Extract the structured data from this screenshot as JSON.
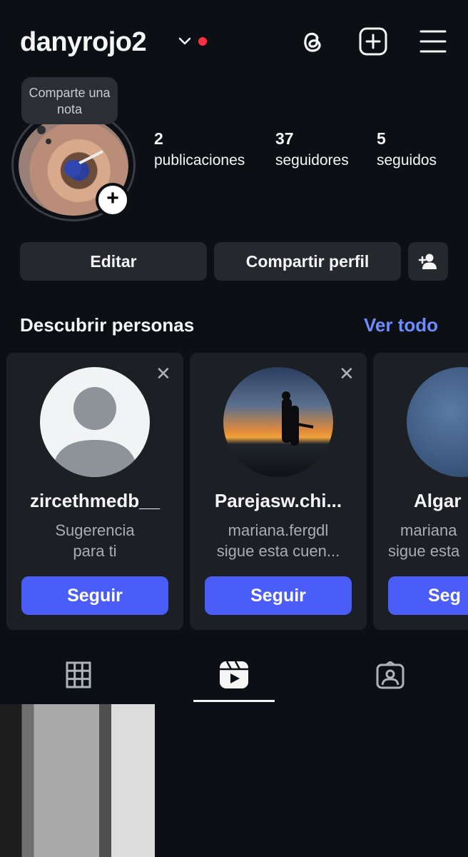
{
  "header": {
    "username": "danyrojo2",
    "icons": [
      "chevron-down-icon",
      "threads-icon",
      "add-square-icon",
      "menu-icon"
    ]
  },
  "profile": {
    "note_placeholder": "Comparte una nota",
    "stats": [
      {
        "value": "2",
        "label": "publicaciones"
      },
      {
        "value": "37",
        "label": "seguidores"
      },
      {
        "value": "5",
        "label": "seguidos"
      }
    ]
  },
  "actions": {
    "edit": "Editar",
    "share": "Compartir perfil"
  },
  "discover": {
    "title": "Descubrir personas",
    "see_all": "Ver todo",
    "cards": [
      {
        "name": "zircethmedb__",
        "sub1": "Sugerencia",
        "sub2": "para ti",
        "button": "Seguir"
      },
      {
        "name": "Parejasw.chi...",
        "sub1": "mariana.fergdl",
        "sub2": "sigue esta cuen...",
        "button": "Seguir"
      },
      {
        "name": "Algar",
        "sub1": "mariana",
        "sub2": "sigue esta",
        "button": "Seg"
      }
    ]
  },
  "tabs": [
    "grid-icon",
    "reels-icon",
    "tagged-icon"
  ],
  "colors": {
    "background": "#0c1014",
    "accent": "#4a5df9",
    "link": "#6c8cff",
    "dot": "#ff3040"
  }
}
